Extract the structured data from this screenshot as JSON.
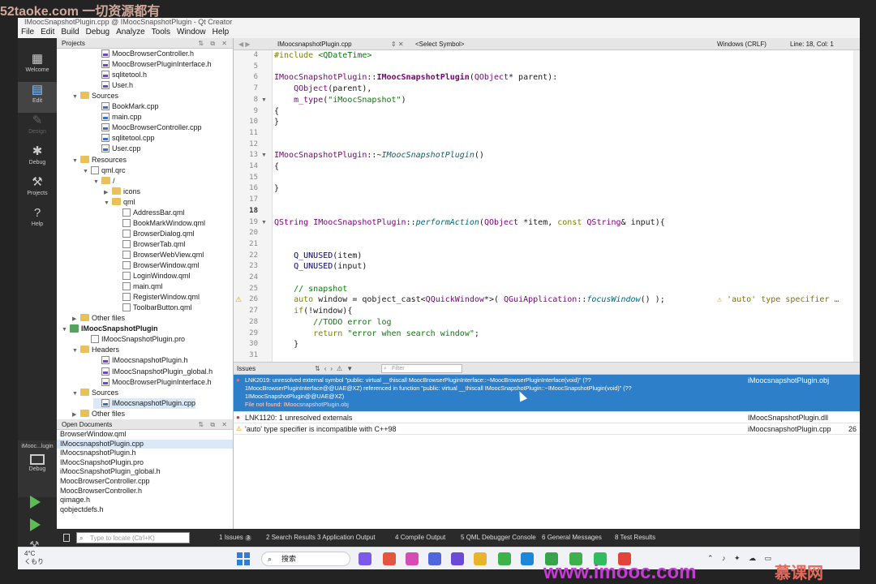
{
  "window": {
    "title": "IMoocSnapshotPlugin.cpp @ IMoocSnapshotPlugin - Qt Creator"
  },
  "menu": [
    "File",
    "Edit",
    "Build",
    "Debug",
    "Analyze",
    "Tools",
    "Window",
    "Help"
  ],
  "modes": [
    {
      "label": "Welcome",
      "icon": "grid-icon"
    },
    {
      "label": "Edit",
      "icon": "edit-icon"
    },
    {
      "label": "Design",
      "icon": "pen-icon"
    },
    {
      "label": "Debug",
      "icon": "bug-icon"
    },
    {
      "label": "Projects",
      "icon": "wrench-icon"
    },
    {
      "label": "Help",
      "icon": "help-icon"
    }
  ],
  "projects_panel": {
    "title": "Projects"
  },
  "tree": [
    {
      "label": "MoocBrowserController.h",
      "kind": "h"
    },
    {
      "label": "MoocBrowserPluginInterface.h",
      "kind": "h"
    },
    {
      "label": "sqlitetool.h",
      "kind": "h"
    },
    {
      "label": "User.h",
      "kind": "h"
    },
    {
      "label": "Sources",
      "kind": "folder"
    },
    {
      "label": "BookMark.cpp",
      "kind": "c"
    },
    {
      "label": "main.cpp",
      "kind": "c"
    },
    {
      "label": "MoocBrowserController.cpp",
      "kind": "c"
    },
    {
      "label": "sqlitetool.cpp",
      "kind": "c"
    },
    {
      "label": "User.cpp",
      "kind": "c"
    },
    {
      "label": "Resources",
      "kind": "folder"
    },
    {
      "label": "qml.qrc",
      "kind": "file"
    },
    {
      "label": "/",
      "kind": "folder"
    },
    {
      "label": "icons",
      "kind": "folder"
    },
    {
      "label": "qml",
      "kind": "folder"
    },
    {
      "label": "AddressBar.qml",
      "kind": "file"
    },
    {
      "label": "BookMarkWindow.qml",
      "kind": "file"
    },
    {
      "label": "BrowserDialog.qml",
      "kind": "file"
    },
    {
      "label": "BrowserTab.qml",
      "kind": "file"
    },
    {
      "label": "BrowserWebView.qml",
      "kind": "file"
    },
    {
      "label": "BrowserWindow.qml",
      "kind": "file"
    },
    {
      "label": "LoginWindow.qml",
      "kind": "file"
    },
    {
      "label": "main.qml",
      "kind": "file"
    },
    {
      "label": "RegisterWindow.qml",
      "kind": "file"
    },
    {
      "label": "ToolbarButton.qml",
      "kind": "file"
    },
    {
      "label": "Other files",
      "kind": "folder"
    },
    {
      "label": "IMoocSnapshotPlugin",
      "kind": "project"
    },
    {
      "label": "IMoocSnapshotPlugin.pro",
      "kind": "file"
    },
    {
      "label": "Headers",
      "kind": "folder"
    },
    {
      "label": "IMoocsnapshotPlugin.h",
      "kind": "h"
    },
    {
      "label": "IMoocSnapshotPlugin_global.h",
      "kind": "h"
    },
    {
      "label": "MoocBrowserPluginInterface.h",
      "kind": "h"
    },
    {
      "label": "Sources",
      "kind": "folder"
    },
    {
      "label": "IMoocsnapshotPlugin.cpp",
      "kind": "c"
    },
    {
      "label": "Other files",
      "kind": "folder"
    }
  ],
  "open_documents": {
    "title": "Open Documents",
    "items": [
      "BrowserWindow.qml",
      "IMoocsnapshotPlugin.cpp",
      "IMoocsnapshotPlugin.h",
      "IMoocSnapshotPlugin.pro",
      "iMoocSnapshotPlugin_global.h",
      "MoocBrowserController.cpp",
      "MoocBrowserController.h",
      "qimage.h",
      "qobjectdefs.h"
    ]
  },
  "device": {
    "label": "iMooc...lugin",
    "mode": "Debug"
  },
  "editor_toolbar": {
    "file": "IMoocsnapshotPlugin.cpp",
    "symbol": "<Select Symbol>",
    "encoding": "Windows (CRLF)",
    "position": "Line: 18, Col: 1"
  },
  "code": {
    "line_numbers": [
      "4",
      "5",
      "6",
      "7",
      "8",
      "9",
      "10",
      "11",
      "12",
      "13",
      "14",
      "15",
      "16",
      "17",
      "18",
      "19",
      "20",
      "21",
      "22",
      "23",
      "24",
      "25",
      "26",
      "27",
      "28",
      "29",
      "30",
      "31"
    ],
    "warning_annotation": "'auto' type specifier …"
  },
  "issues": {
    "title": "Issues",
    "filter_placeholder": "Filter",
    "items": [
      {
        "severity": "error",
        "text": "LNK2019: unresolved external symbol \"public: virtual __thiscall MoocBrowserPluginInterface::~MoocBrowserPluginInterface(void)\" (??",
        "text2": "1MoocBrowserPluginInterface@@UAE@XZ) referenced in function \"public: virtual __thiscall IMoocSnapshotPlugin::~IMoocSnapshotPlugin(void)\" (??",
        "text3": "1IMoocSnapshotPlugin@@UAE@XZ)",
        "text4": "File not found: IMoocsnapshotPlugin.obj",
        "file": "iMoocsnapshotPlugin.obj",
        "line": ""
      },
      {
        "severity": "error",
        "text": "LNK1120: 1 unresolved externals",
        "file": "IMoocSnapshotPlugin.dll",
        "line": ""
      },
      {
        "severity": "warning",
        "text": "'auto' type specifier is incompatible with C++98",
        "file": "iMoocsnapshotPlugin.cpp",
        "line": "26"
      }
    ]
  },
  "output_bar": {
    "locator_placeholder": "Type to locate (Ctrl+K)",
    "tabs": [
      {
        "num": "1",
        "label": "Issues",
        "badge": "3"
      },
      {
        "num": "2",
        "label": "Search Results"
      },
      {
        "num": "3",
        "label": "Application Output"
      },
      {
        "num": "4",
        "label": "Compile Output"
      },
      {
        "num": "5",
        "label": "QML Debugger Console"
      },
      {
        "num": "6",
        "label": "General Messages"
      },
      {
        "num": "8",
        "label": "Test Results"
      }
    ]
  },
  "taskbar": {
    "weather_temp": "4°C",
    "weather_desc": "くもり",
    "search_label": "搜索"
  },
  "watermarks": {
    "top": "52taoke.com 一切资源都有",
    "bottom": "www.imooc.com",
    "bottom_right": "慕课网"
  }
}
